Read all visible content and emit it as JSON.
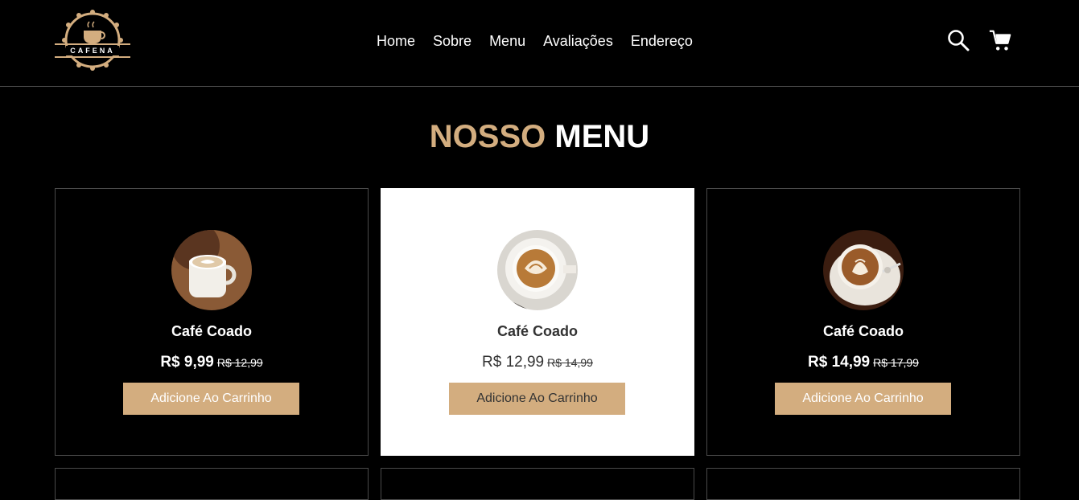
{
  "header": {
    "logo_text": "CAFENA",
    "nav": [
      {
        "label": "Home"
      },
      {
        "label": "Sobre"
      },
      {
        "label": "Menu"
      },
      {
        "label": "Avaliações"
      },
      {
        "label": "Endereço"
      }
    ],
    "icons": [
      "search-icon",
      "cart-icon"
    ]
  },
  "menu": {
    "title_accent": "NOSSO",
    "title_main": "MENU",
    "items": [
      {
        "name": "Café Coado",
        "price": "R$ 9,99",
        "old_price": "R$ 12,99",
        "button": "Adicione Ao Carrinho"
      },
      {
        "name": "Café Coado",
        "price": "R$ 12,99",
        "old_price": "R$ 14,99",
        "button": "Adicione Ao Carrinho"
      },
      {
        "name": "Café Coado",
        "price": "R$ 14,99",
        "old_price": "R$ 17,99",
        "button": "Adicione Ao Carrinho"
      }
    ]
  },
  "colors": {
    "accent": "#d3ad7f",
    "background": "#000000",
    "active_card": "#ffffff"
  }
}
